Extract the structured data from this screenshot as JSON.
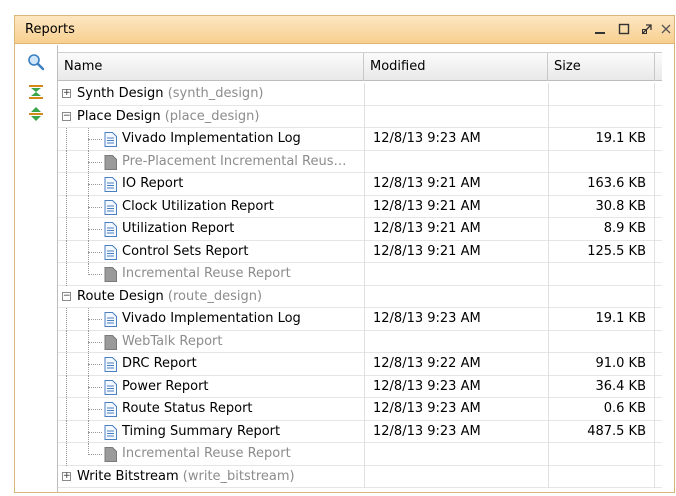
{
  "panel": {
    "title": "Reports",
    "window_buttons": [
      "minimize-icon",
      "maximize-icon",
      "float-icon",
      "close-icon"
    ],
    "accent_color": "#f7cf8f"
  },
  "tools": [
    "search-icon",
    "collapse-all-icon",
    "expand-all-icon"
  ],
  "columns": {
    "name": "Name",
    "modified": "Modified",
    "size": "Size"
  },
  "rows": [
    {
      "kind": "group",
      "expanded": false,
      "label": "Synth Design",
      "sub": "(synth_design)"
    },
    {
      "kind": "group",
      "expanded": true,
      "label": "Place Design",
      "sub": "(place_design)"
    },
    {
      "kind": "leaf",
      "label": "Vivado Implementation Log",
      "modified": "12/8/13 9:23 AM",
      "size": "19.1 KB",
      "disabled": false
    },
    {
      "kind": "leaf",
      "label": "Pre-Placement Incremental Reus…",
      "modified": "",
      "size": "",
      "disabled": true
    },
    {
      "kind": "leaf",
      "label": "IO Report",
      "modified": "12/8/13 9:21 AM",
      "size": "163.6 KB",
      "disabled": false
    },
    {
      "kind": "leaf",
      "label": "Clock Utilization Report",
      "modified": "12/8/13 9:21 AM",
      "size": "30.8 KB",
      "disabled": false
    },
    {
      "kind": "leaf",
      "label": "Utilization Report",
      "modified": "12/8/13 9:21 AM",
      "size": "8.9 KB",
      "disabled": false
    },
    {
      "kind": "leaf",
      "label": "Control Sets Report",
      "modified": "12/8/13 9:21 AM",
      "size": "125.5 KB",
      "disabled": false
    },
    {
      "kind": "leaf",
      "label": "Incremental Reuse Report",
      "modified": "",
      "size": "",
      "disabled": true,
      "last": true
    },
    {
      "kind": "group",
      "expanded": true,
      "label": "Route Design",
      "sub": "(route_design)"
    },
    {
      "kind": "leaf",
      "label": "Vivado Implementation Log",
      "modified": "12/8/13 9:23 AM",
      "size": "19.1 KB",
      "disabled": false
    },
    {
      "kind": "leaf",
      "label": "WebTalk Report",
      "modified": "",
      "size": "",
      "disabled": true
    },
    {
      "kind": "leaf",
      "label": "DRC Report",
      "modified": "12/8/13 9:22 AM",
      "size": "91.0 KB",
      "disabled": false
    },
    {
      "kind": "leaf",
      "label": "Power Report",
      "modified": "12/8/13 9:23 AM",
      "size": "36.4 KB",
      "disabled": false
    },
    {
      "kind": "leaf",
      "label": "Route Status Report",
      "modified": "12/8/13 9:23 AM",
      "size": "0.6 KB",
      "disabled": false
    },
    {
      "kind": "leaf",
      "label": "Timing Summary Report",
      "modified": "12/8/13 9:23 AM",
      "size": "487.5 KB",
      "disabled": false
    },
    {
      "kind": "leaf",
      "label": "Incremental Reuse Report",
      "modified": "",
      "size": "",
      "disabled": true,
      "last": true
    },
    {
      "kind": "group",
      "expanded": false,
      "label": "Write Bitstream",
      "sub": "(write_bitstream)"
    }
  ]
}
